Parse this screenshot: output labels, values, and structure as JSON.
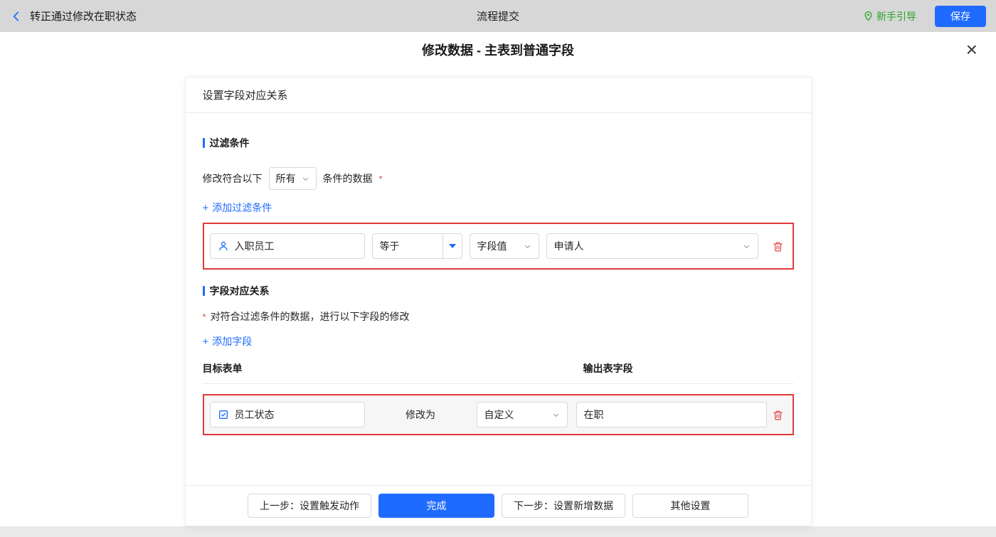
{
  "topbar": {
    "title": "转正通过修改在职状态",
    "center_title": "流程提交",
    "guide_label": "新手引导",
    "save_label": "保存"
  },
  "modal": {
    "title": "修改数据 - 主表到普通字段",
    "close_icon": "×"
  },
  "card": {
    "header_title": "设置字段对应关系",
    "filter": {
      "section_title": "过滤条件",
      "line_prefix": "修改符合以下",
      "match_value": "所有",
      "line_suffix": "条件的数据",
      "required_mark": "*",
      "add_plus": "+",
      "add_link": "添加过滤条件",
      "row": {
        "field": "入职员工",
        "operator": "等于",
        "value_type": "字段值",
        "value": "申请人"
      }
    },
    "mapping": {
      "section_title": "字段对应关系",
      "required_mark": "*",
      "description": "对符合过滤条件的数据，进行以下字段的修改",
      "add_plus": "+",
      "add_link": "添加字段",
      "col_target": "目标表单",
      "col_output": "输出表字段",
      "row": {
        "target_field": "员工状态",
        "modify_label": "修改为",
        "mode": "自定义",
        "value": "在职"
      }
    },
    "footer": {
      "prev": "上一步：设置触发动作",
      "done": "完成",
      "next": "下一步：设置新增数据",
      "other": "其他设置"
    }
  },
  "colors": {
    "accent_blue": "#1f6bff",
    "guide_green": "#2aa52a",
    "highlight_red": "#e23a3a",
    "danger_red": "#e34444"
  }
}
